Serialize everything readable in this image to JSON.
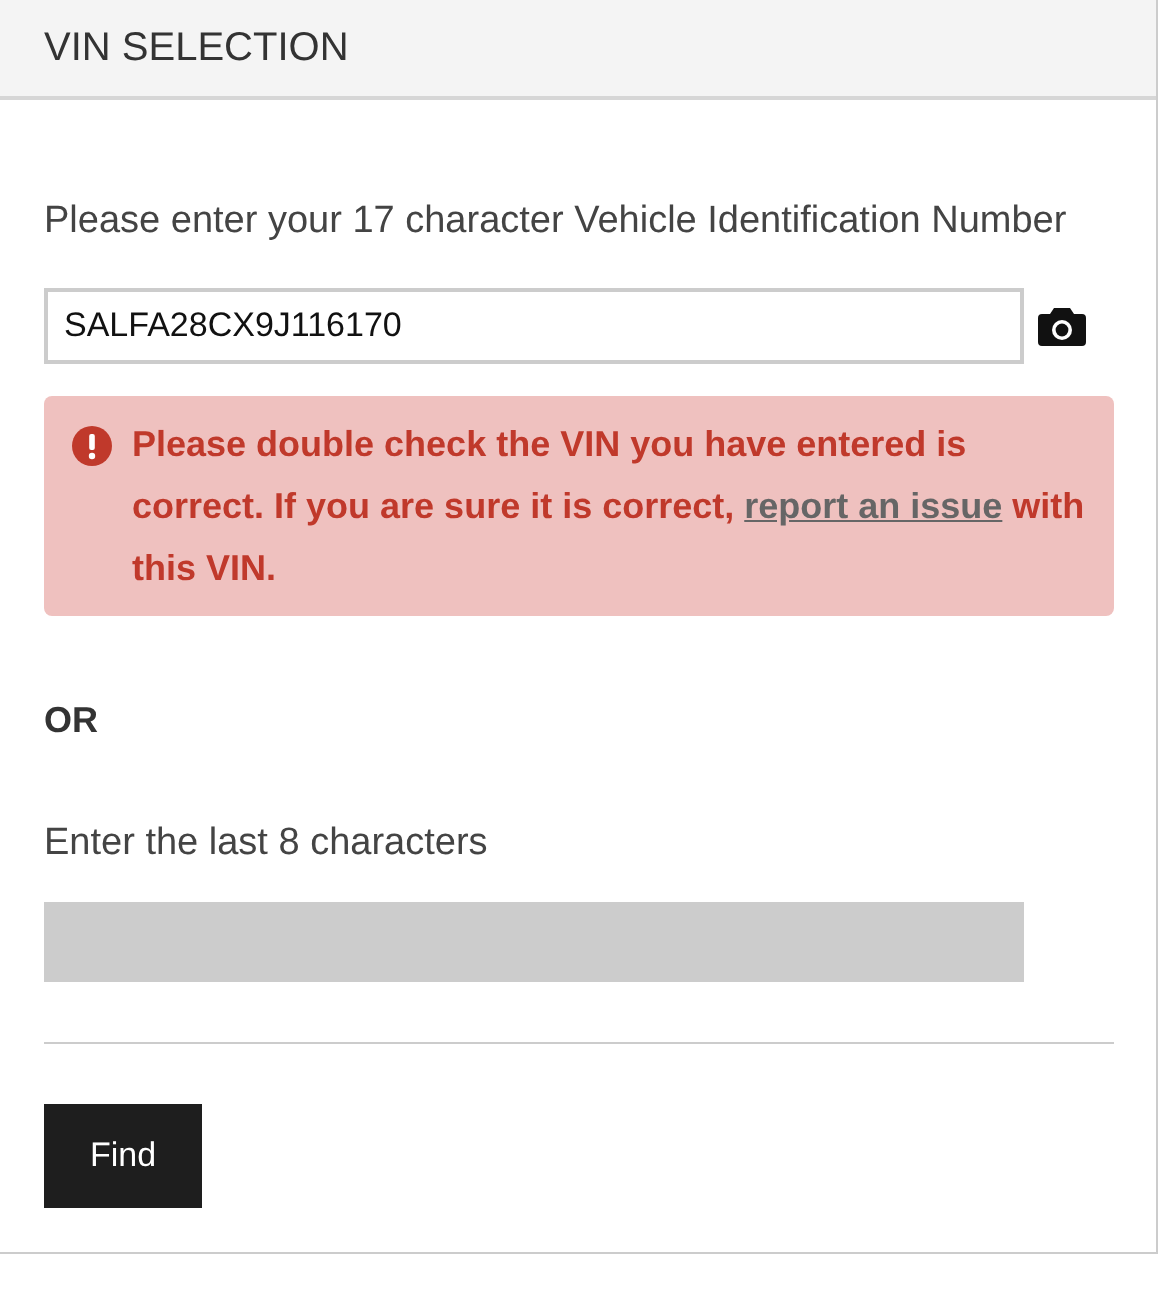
{
  "header": {
    "title": "VIN SELECTION"
  },
  "vin_field": {
    "label": "Please enter your 17 character Vehicle Identification Number",
    "value": "SALFA28CX9J116170"
  },
  "error": {
    "text_before": "Please double check the VIN you have entered is correct. If you are sure it is correct, ",
    "link": "report an issue",
    "text_after": " with this VIN."
  },
  "separator": "OR",
  "last8_field": {
    "label": "Enter the last 8 characters",
    "disabled": true
  },
  "buttons": [
    {
      "label": "Find"
    }
  ]
}
